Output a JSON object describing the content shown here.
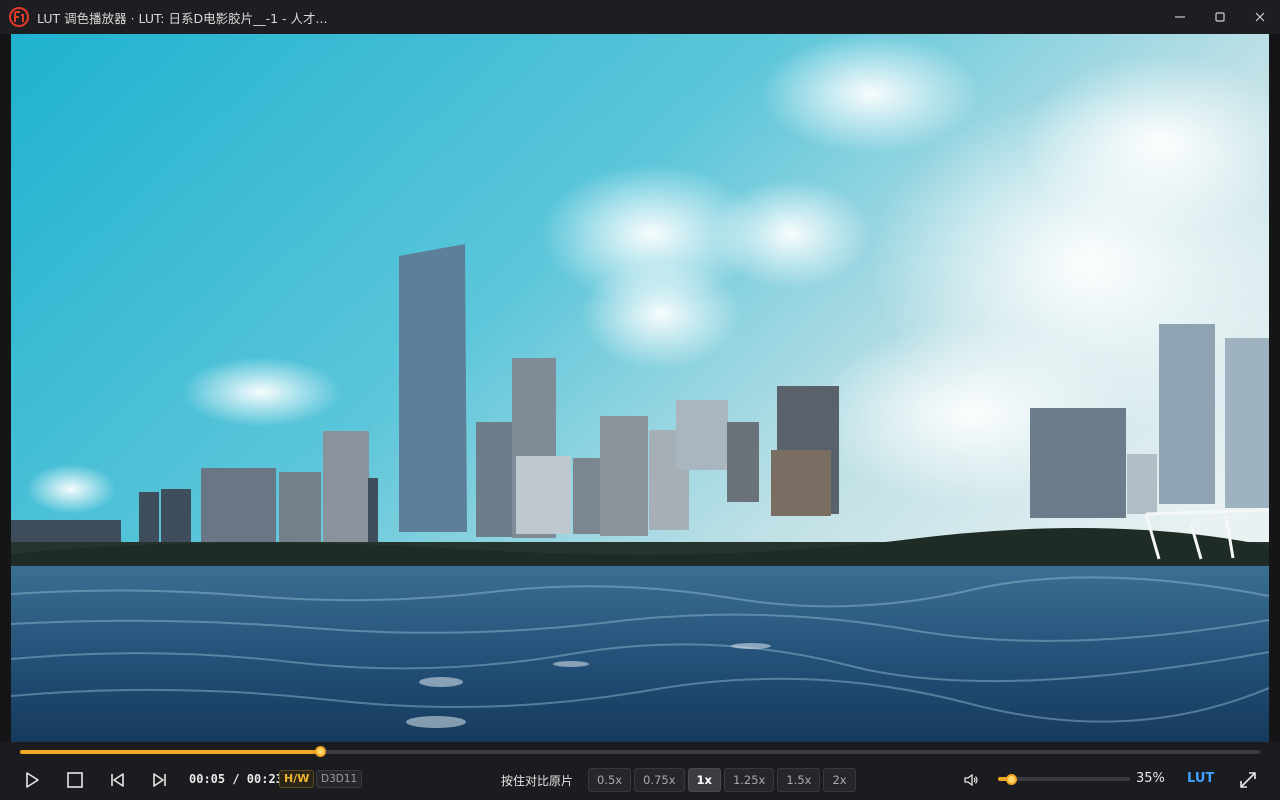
{
  "window": {
    "title": "LUT 调色播放器 · LUT: 日系D电影胶片__-1 - 人才...",
    "logo_icon": "app-logo-icon",
    "controls": [
      "minimize-icon",
      "maximize-icon",
      "close-icon"
    ]
  },
  "video": {
    "description_icon": "video-frame"
  },
  "playback": {
    "progress": 0.242,
    "current_time": "00:05",
    "duration": "00:23",
    "time_display": "00:05 / 00:23",
    "hw_badge": "H/W",
    "renderer_badge": "D3D11",
    "compare_label": "按住对比原片",
    "speeds": [
      "0.5x",
      "0.75x",
      "1x",
      "1.25x",
      "1.5x",
      "2x"
    ],
    "active_speed": "1x",
    "volume": 0.1,
    "volume_label": "35%",
    "lut_label": "LUT"
  },
  "colors": {
    "accent": "#f0a623",
    "lut_blue": "#3fa0ff",
    "background": "#1b1c1f"
  }
}
